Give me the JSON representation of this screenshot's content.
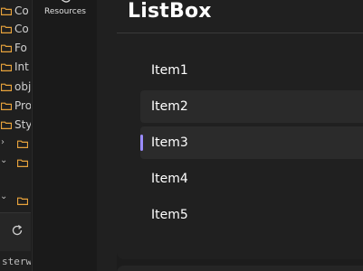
{
  "tree": {
    "items": [
      {
        "label": "Co"
      },
      {
        "label": "Co"
      },
      {
        "label": "Fo"
      },
      {
        "label": "Int"
      },
      {
        "label": "obj"
      },
      {
        "label": "Pro"
      },
      {
        "label": "Sty"
      },
      {
        "label": ""
      },
      {
        "label": ""
      }
    ],
    "footer_text": "sterwi"
  },
  "rail": {
    "resources_label": "Resources"
  },
  "page": {
    "title": "ListBox"
  },
  "listbox": {
    "items": [
      {
        "label": "Item1"
      },
      {
        "label": "Item2"
      },
      {
        "label": "Item3"
      },
      {
        "label": "Item4"
      },
      {
        "label": "Item5"
      }
    ],
    "selected_index": 2,
    "hovered_index": 1
  },
  "colors": {
    "accent": "#9b8cff",
    "folder": "#e8a33c",
    "background": "#1c1c1c"
  }
}
